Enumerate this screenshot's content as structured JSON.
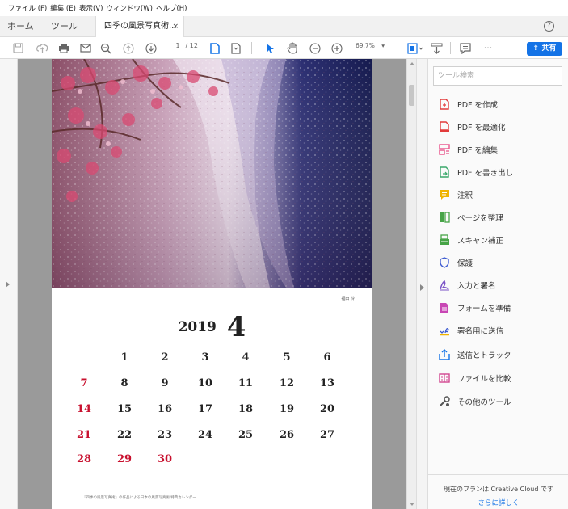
{
  "menu": [
    "ファイル (F)",
    "編集 (E)",
    "表示(V)",
    "ウィンドウ(W)",
    "ヘルプ(H)"
  ],
  "tabs": {
    "home": "ホーム",
    "tools": "ツール",
    "document": "四季の風景写真術...",
    "close": "×",
    "help": "?"
  },
  "toolbar": {
    "current_page": "1",
    "total_pages": "/ 12",
    "zoom": "69.7%",
    "share": "共有"
  },
  "calendar": {
    "year": "2019",
    "month": "4",
    "photographer": "福田 怜",
    "weeks": [
      [
        "",
        "1",
        "2",
        "3",
        "4",
        "5",
        "6"
      ],
      [
        "7",
        "8",
        "9",
        "10",
        "11",
        "12",
        "13"
      ],
      [
        "14",
        "15",
        "16",
        "17",
        "18",
        "19",
        "20"
      ],
      [
        "21",
        "22",
        "23",
        "24",
        "25",
        "26",
        "27"
      ],
      [
        "28",
        "29",
        "30",
        "",
        "",
        "",
        ""
      ]
    ],
    "holiday_color": "#c8102e",
    "footnote": "『四季の風景写真術』の作品による日本の風景写真術 特典カレンダー"
  },
  "tools_pane": {
    "search_placeholder": "ツール検索",
    "items": [
      {
        "label": "PDF を作成",
        "icon": "create-pdf-icon",
        "color": "#e23b3b"
      },
      {
        "label": "PDF を最適化",
        "icon": "optimize-pdf-icon",
        "color": "#e23b3b"
      },
      {
        "label": "PDF を編集",
        "icon": "edit-pdf-icon",
        "color": "#e8538a"
      },
      {
        "label": "PDF を書き出し",
        "icon": "export-pdf-icon",
        "color": "#3aa86b"
      },
      {
        "label": "注釈",
        "icon": "comment-icon",
        "color": "#f0b400"
      },
      {
        "label": "ページを整理",
        "icon": "organize-pages-icon",
        "color": "#47a447"
      },
      {
        "label": "スキャン補正",
        "icon": "scan-icon",
        "color": "#47a447"
      },
      {
        "label": "保護",
        "icon": "protect-icon",
        "color": "#3d5bd1"
      },
      {
        "label": "入力と署名",
        "icon": "fill-sign-icon",
        "color": "#7a52c7"
      },
      {
        "label": "フォームを準備",
        "icon": "prepare-form-icon",
        "color": "#c846b4"
      },
      {
        "label": "署名用に送信",
        "icon": "send-for-signature-icon",
        "color": "#3d5bd1"
      },
      {
        "label": "送信とトラック",
        "icon": "send-track-icon",
        "color": "#1473e6"
      },
      {
        "label": "ファイルを比較",
        "icon": "compare-files-icon",
        "color": "#d1458f"
      },
      {
        "label": "その他のツール",
        "icon": "more-tools-icon",
        "color": "#555555"
      }
    ],
    "plan_text": "現在のプランは Creative Cloud です",
    "plan_link": "さらに詳しく"
  },
  "colors": {
    "accent": "#1473e6"
  }
}
